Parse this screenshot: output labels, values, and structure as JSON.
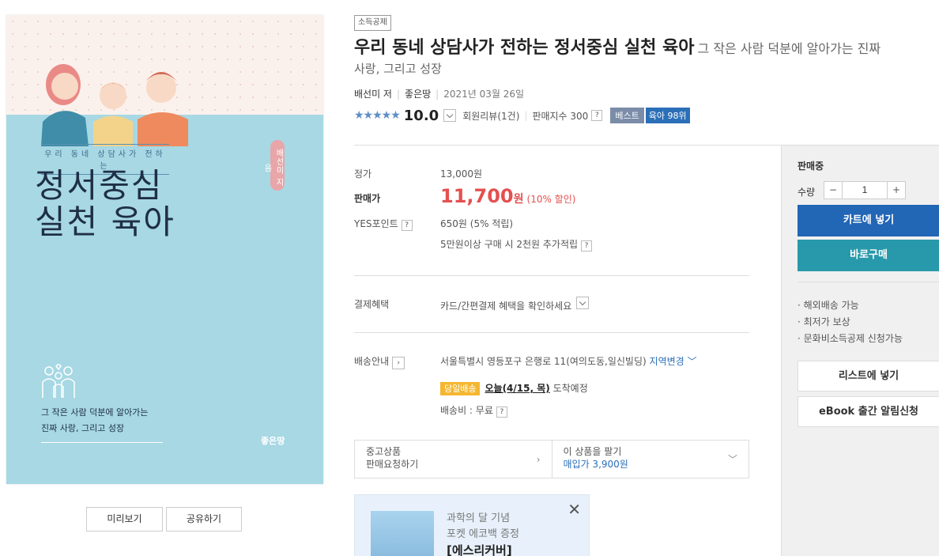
{
  "cover": {
    "subtitle": "우리 동네 상담사가 전하는",
    "title_line1": "정서중심",
    "title_line2": "실천 육아",
    "author": "배선미 지음",
    "tagline_line1": "그 작은 사람 덕분에 알아가는",
    "tagline_line2": "진짜 사랑, 그리고 성장",
    "publisher": "좋은땅"
  },
  "buttons": {
    "preview": "미리보기",
    "share": "공유하기"
  },
  "tag": "소득공제",
  "book": {
    "title": "우리 동네 상담사가 전하는 정서중심 실천 육아",
    "subtitle_part1": "그 작은 사람 덕분에 알아가는 진짜",
    "subtitle_part2": "사랑, 그리고 성장",
    "author": "배선미 저",
    "publisher": "좋은땅",
    "date": "2021년 03월 26일"
  },
  "rating": {
    "stars": "★★★★★",
    "score": "10.0",
    "reviews": "회원리뷰(1건)",
    "sales_index": "판매지수 300",
    "help": "?",
    "best_label": "베스트",
    "best_rank": "육아 98위"
  },
  "price": {
    "list_label": "정가",
    "list_value": "13,000원",
    "sale_label": "판매가",
    "sale_value": "11,700",
    "sale_unit": "원",
    "discount": "(10% 할인)",
    "point_label": "YES포인트",
    "point_value": "650원 (5% 적립)",
    "point_extra": "5만원이상 구매 시 2천원 추가적립"
  },
  "payment": {
    "label": "결제혜택",
    "value": "카드/간편결제 혜택을 확인하세요"
  },
  "shipping": {
    "label": "배송안내",
    "address": "서울특별시 영등포구 은행로 11(여의도동,일신빌딩)",
    "region_change": "지역변경",
    "same_day": "당일배송",
    "today": "오늘(4/15, 목)",
    "arrival": "도착예정",
    "fee": "배송비 : 무료"
  },
  "used": {
    "left_line1": "중고상품",
    "left_line2": "판매요청하기",
    "right_line1": "이 상품을 팔기",
    "right_line2": "매입가 3,900원"
  },
  "promo": {
    "line1": "과학의 달 기념",
    "line2": "포켓 에코백 증정",
    "line3": "[에스리커버]"
  },
  "sidebar": {
    "status": "판매중",
    "qty_label": "수량",
    "qty_minus": "−",
    "qty_value": "1",
    "qty_plus": "+",
    "cart": "카트에 넣기",
    "buy_now": "바로구매",
    "info": [
      "· 해외배송 가능",
      "· 최저가 보상",
      "· 문화비소득공제 신청가능"
    ],
    "wishlist": "리스트에 넣기",
    "ebook_alert": "eBook 출간 알림신청"
  },
  "colors": {
    "accent_blue": "#2266b6",
    "accent_teal": "#2899aa",
    "price_red": "#e55050",
    "cover_blue": "#a7d8e4"
  }
}
